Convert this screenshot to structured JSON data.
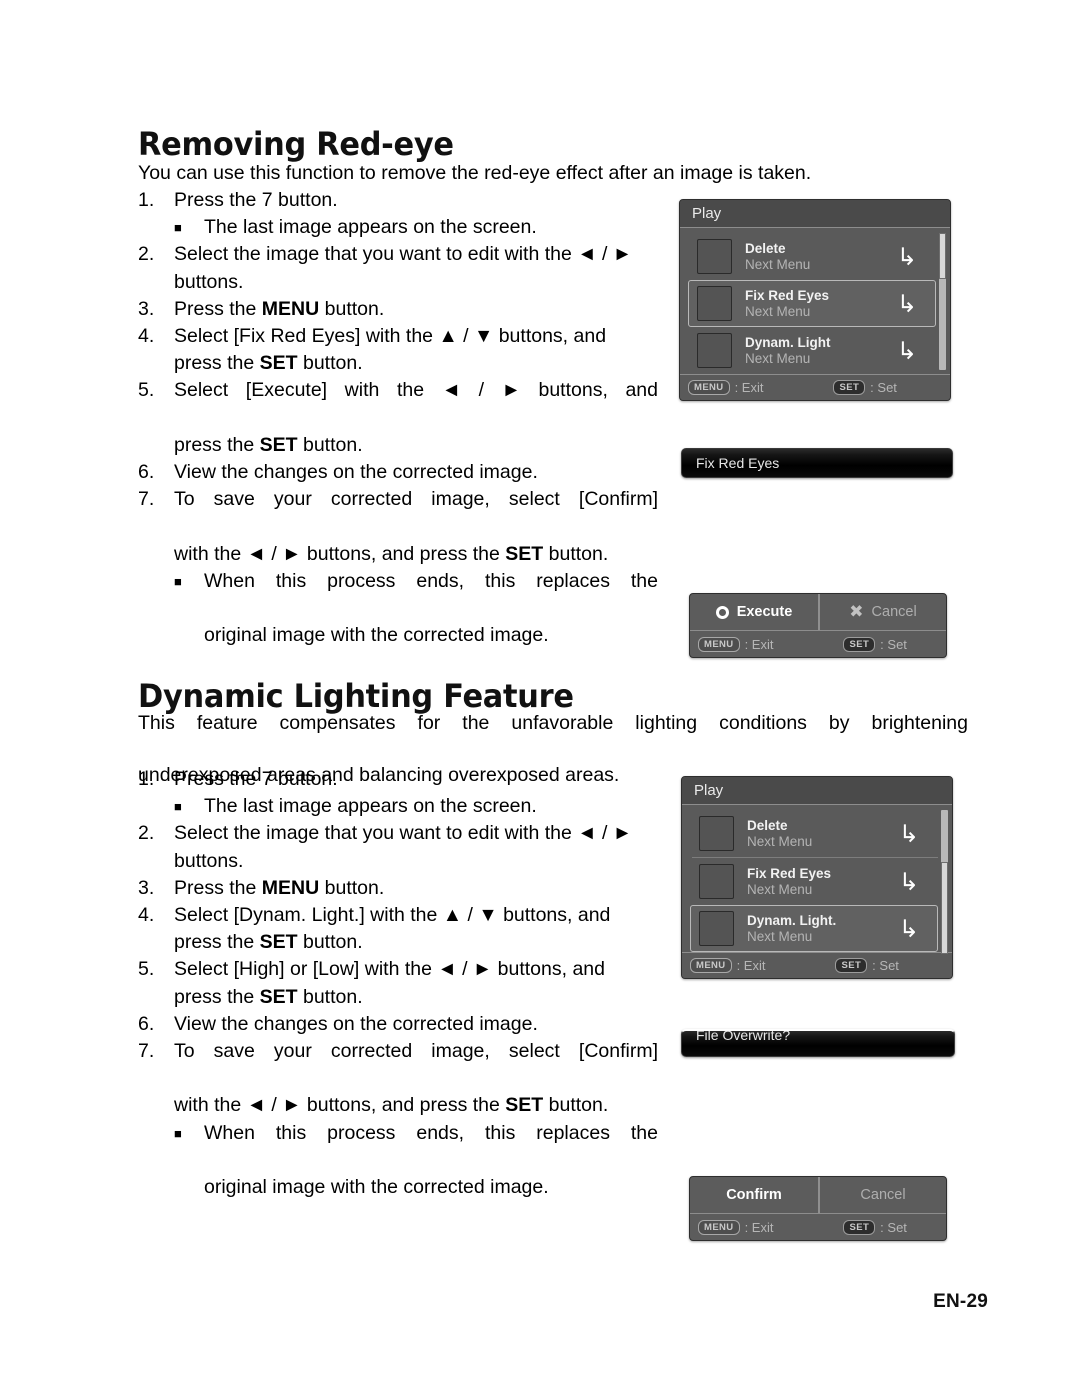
{
  "page": {
    "number_label": "EN-29"
  },
  "sections": [
    {
      "heading": "Removing Red-eye",
      "intro": "You can use this function to remove the red-eye effect after an image is taken.",
      "steps": [
        {
          "num": "1.",
          "text": "Press the 7  button.",
          "sub": {
            "bullet": "■",
            "text": "The last image appears on the screen."
          }
        },
        {
          "num": "2.",
          "line1": "Select the image that you want to edit with the ◄ /",
          "line2": "► buttons."
        },
        {
          "num": "3.",
          "text_pre": "Press the ",
          "bold": "MENU",
          "text_post": " button."
        },
        {
          "num": "4.",
          "line1_pre": "Select [Fix Red Eyes] with the ▲ / ▼ buttons, and",
          "line2_pre": "press the ",
          "line2_bold": "SET",
          "line2_post": " button."
        },
        {
          "num": "5.",
          "line1": "Select [Execute] with the ◄ / ► buttons, and",
          "line2_pre": "press the ",
          "line2_bold": "SET",
          "line2_post": " button."
        },
        {
          "num": "6.",
          "text": "View the changes on the corrected image."
        },
        {
          "num": "7.",
          "line1": "To save your corrected image, select [Confirm]",
          "line2_pre": "with the ◄ / ► buttons, and press the ",
          "line2_bold": "SET",
          "line2_post": " button.",
          "sub": {
            "bullet": "■",
            "line1": "When this process ends, this replaces the",
            "line2": "original image with the corrected image."
          }
        }
      ]
    },
    {
      "heading": "Dynamic Lighting Feature",
      "intro_line1": "This feature compensates for the unfavorable lighting conditions by brightening",
      "intro_line2": "underexposed areas and balancing overexposed areas.",
      "steps": [
        {
          "num": "1.",
          "text": "Press the 7  button.",
          "sub": {
            "bullet": "■",
            "text": "The last image appears on the screen."
          }
        },
        {
          "num": "2.",
          "line1": "Select the image that you want to edit with the ◄ /",
          "line2": "► buttons."
        },
        {
          "num": "3.",
          "text_pre": "Press the ",
          "bold": "MENU",
          "text_post": " button."
        },
        {
          "num": "4.",
          "line1_pre": "Select [Dynam. Light.] with the ▲ / ▼ buttons, and",
          "line2_pre": "press the ",
          "line2_bold": "SET",
          "line2_post": " button."
        },
        {
          "num": "5.",
          "line1": "Select [High] or [Low]  with the ◄ / ► buttons, and",
          "line2_pre": "press the ",
          "line2_bold": "SET",
          "line2_post": " button."
        },
        {
          "num": "6.",
          "text": "View the changes on the corrected image."
        },
        {
          "num": "7.",
          "line1": "To save your corrected image, select [Confirm]",
          "line2_pre": "with the ◄ / ► buttons, and press the ",
          "line2_bold": "SET",
          "line2_post": " button.",
          "sub": {
            "bullet": "■",
            "line1": "When this process ends, this replaces the",
            "line2": "original image with the corrected image."
          }
        }
      ]
    }
  ],
  "screens": {
    "play_menu_1": {
      "title": "Play",
      "rows": [
        {
          "label": "Delete",
          "sublabel": "Next Menu",
          "arrow_icon": "↳",
          "selected": false
        },
        {
          "label": "Fix Red Eyes",
          "sublabel": "Next Menu",
          "arrow_icon": "↳",
          "selected": true
        },
        {
          "label": "Dynam. Light",
          "sublabel": "Next Menu",
          "arrow_icon": "↳",
          "selected": false
        }
      ],
      "footer": {
        "menu_key": "MENU",
        "menu_action": ": Exit",
        "set_key": "SET",
        "set_action": ": Set"
      }
    },
    "play_menu_2": {
      "title": "Play",
      "rows": [
        {
          "label": "Delete",
          "sublabel": "Next Menu",
          "arrow_icon": "↳",
          "selected": false
        },
        {
          "label": "Fix Red Eyes",
          "sublabel": "Next Menu",
          "arrow_icon": "↳",
          "selected": false
        },
        {
          "label": "Dynam. Light.",
          "sublabel": "Next Menu",
          "arrow_icon": "↳",
          "selected": true
        }
      ],
      "footer": {
        "menu_key": "MENU",
        "menu_action": ": Exit",
        "set_key": "SET",
        "set_action": ": Set"
      }
    },
    "fix_red_eyes_bar": {
      "title": "Fix Red Eyes"
    },
    "file_overwrite_bar": {
      "title": "File Overwrite?"
    },
    "execute_dialog": {
      "option_active": "Execute",
      "option_active_icon": "ring-icon",
      "option_inactive": "Cancel",
      "option_inactive_icon": "✖",
      "footer": {
        "menu_key": "MENU",
        "menu_action": ": Exit",
        "set_key": "SET",
        "set_action": ": Set"
      }
    },
    "confirm_dialog": {
      "option_active": "Confirm",
      "option_inactive": "Cancel",
      "footer": {
        "menu_key": "MENU",
        "menu_action": ": Exit",
        "set_key": "SET",
        "set_action": ": Set"
      }
    }
  }
}
